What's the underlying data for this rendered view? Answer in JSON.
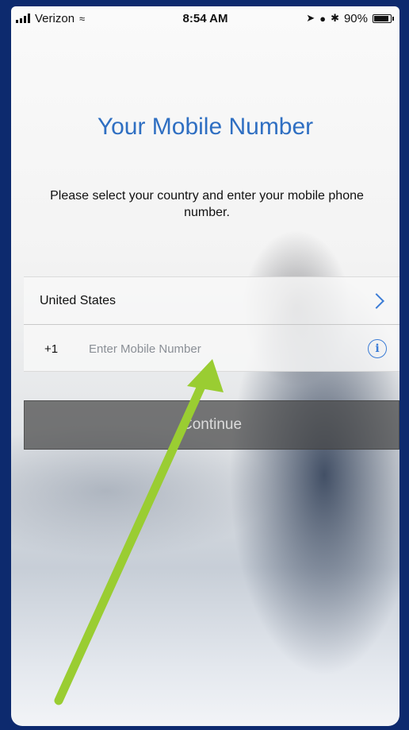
{
  "status_bar": {
    "carrier": "Verizon",
    "time": "8:54 AM",
    "battery": "90%",
    "battery_level": 0.9
  },
  "page": {
    "title": "Your Mobile Number",
    "subtitle": "Please select your country and enter your mobile phone number."
  },
  "form": {
    "country": "United States",
    "dial_code": "+1",
    "phone_placeholder": "Enter Mobile Number",
    "phone_value": ""
  },
  "actions": {
    "continue_label": "Continue"
  },
  "annotation": {
    "arrow_color": "#9acd32"
  },
  "colors": {
    "frame": "#0d2a6e",
    "accent": "#3b7cd6",
    "title": "#2f6fc2"
  }
}
